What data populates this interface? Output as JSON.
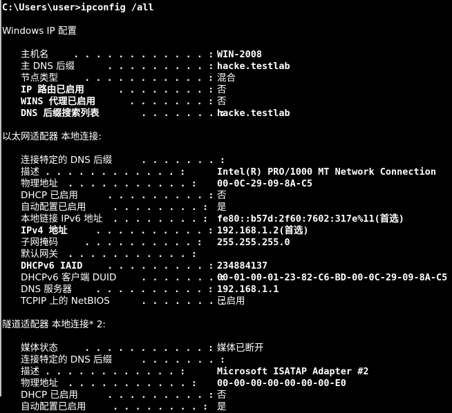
{
  "window": {
    "title": "C:\\Windows\\system32\\cmd.exe",
    "background_color": "#000000",
    "foreground_color": "#ffffff",
    "frame_color": "#c0c0c0"
  },
  "terminal": {
    "prompt_line": "C:\\Users\\user>ipconfig /all",
    "section_windows_title": "Windows IP 配置",
    "section_ethernet_title": "以太网适配器 本地连接:",
    "section_tunnel_title": "隧道适配器 本地连接* 2:",
    "colon": ":",
    "windows_ip_config": [
      {
        "label": "主机名",
        "leader": " . . . . . . . . . . . . :",
        "value": "WIN-2008",
        "value_cjk": false
      },
      {
        "label": "主 DNS 后缀",
        "leader": " . . . . . . . . . :",
        "value": "hacke.testlab",
        "value_cjk": false
      },
      {
        "label": "节点类型",
        "leader": " . . . . . . . . . . . :",
        "value": "混合",
        "value_cjk": true
      },
      {
        "label": "IP 路由已启用",
        "leader": " . . . . . . . . :",
        "value": "否",
        "value_cjk": true
      },
      {
        "label": "WINS 代理已启用",
        "leader": " . . . . . . . :",
        "value": "否",
        "value_cjk": true
      },
      {
        "label": "DNS 后缀搜索列表",
        "leader": " . . . . . . . :",
        "value": "hacke.testlab",
        "value_cjk": false
      }
    ],
    "ethernet_adapter": [
      {
        "label": "连接特定的 DNS 后缀",
        "leader": " . . . . . . . :",
        "value": "",
        "value_cjk": false
      },
      {
        "label": "描述",
        "leader": ". . . . . . . . . . . . :",
        "value": "Intel(R) PRO/1000 MT Network Connection",
        "value_cjk": false
      },
      {
        "label": "物理地址",
        "leader": ". . . . . . . . . . . :",
        "value": "00-0C-29-09-8A-C5",
        "value_cjk": false
      },
      {
        "label": "DHCP 已启用",
        "leader": " . . . . . . . . . :",
        "value": "否",
        "value_cjk": true
      },
      {
        "label": "自动配置已启用",
        "leader": ". . . . . . . . :",
        "value": "是",
        "value_cjk": true
      },
      {
        "label": "本地链接 IPv6 地址",
        "leader": ". . . . . . . . :",
        "value": "fe80::b57d:2f60:7602:317e%11(首选)",
        "value_cjk": false
      },
      {
        "label": "IPv4 地址",
        "leader": " . . . . . . . . . . :",
        "value": "192.168.1.2(首选)",
        "value_cjk": false
      },
      {
        "label": "子网掩码",
        "leader": " . . . . . . . . . . :",
        "value": "255.255.255.0",
        "value_cjk": false
      },
      {
        "label": "默认网关",
        "leader": ". . . . . . . . . . . :",
        "value": "",
        "value_cjk": false
      },
      {
        "label": "DHCPv6 IAID",
        "leader": " . . . . . . . . . :",
        "value": "234884137",
        "value_cjk": false
      },
      {
        "label": "DHCPv6 客户端 DUID",
        "leader": " . . . . . . . :",
        "value": "00-01-00-01-23-82-C6-BD-00-0C-29-09-8A-C5",
        "value_cjk": false
      },
      {
        "label": "DNS 服务器",
        "leader": " . . . . . . . . . . :",
        "value": "192.168.1.1",
        "value_cjk": false
      },
      {
        "label": "TCPIP 上的 NetBIOS",
        "leader": " . . . . . . . :",
        "value": "已启用",
        "value_cjk": true
      }
    ],
    "tunnel_adapter": [
      {
        "label": "媒体状态",
        "leader": " . . . . . . . . . . . :",
        "value": "媒体已断开",
        "value_cjk": true
      },
      {
        "label": "连接特定的 DNS 后缀",
        "leader": " . . . . . . . :",
        "value": "",
        "value_cjk": false
      },
      {
        "label": "描述",
        "leader": ". . . . . . . . . . . . :",
        "value": "Microsoft ISATAP Adapter #2",
        "value_cjk": false
      },
      {
        "label": "物理地址",
        "leader": ". . . . . . . . . . . :",
        "value": "00-00-00-00-00-00-00-E0",
        "value_cjk": false
      },
      {
        "label": "DHCP 已启用",
        "leader": " . . . . . . . . . :",
        "value": "否",
        "value_cjk": true
      },
      {
        "label": "自动配置已启用",
        "leader": ". . . . . . . . :",
        "value": "是",
        "value_cjk": true
      }
    ]
  }
}
